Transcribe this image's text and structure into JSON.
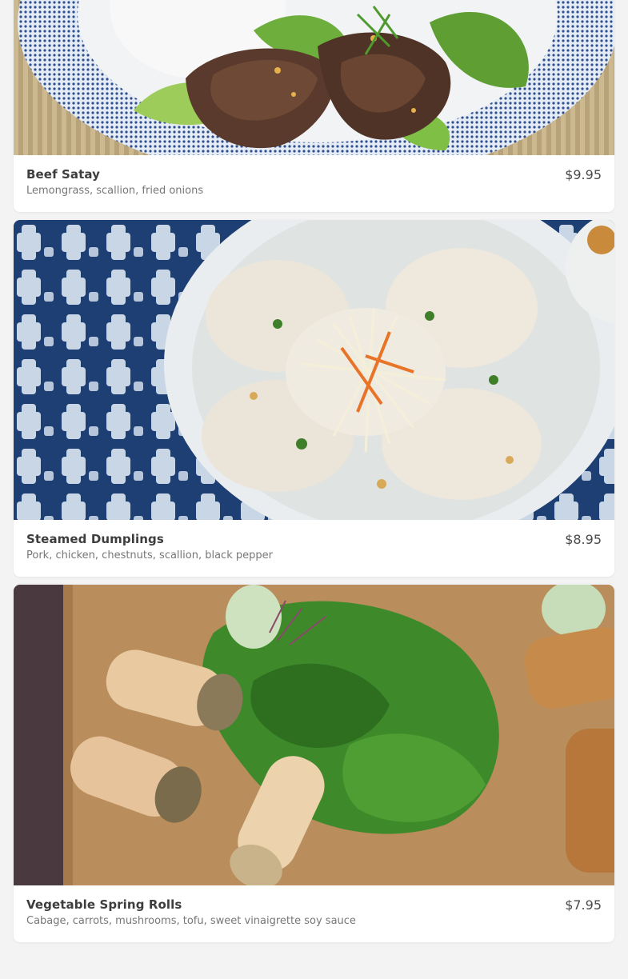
{
  "menu_items": [
    {
      "name": "Beef Satay",
      "description": "Lemongrass, scallion, fried onions",
      "price": "$9.95",
      "photo_icon": "beef-satay-photo"
    },
    {
      "name": "Steamed Dumplings",
      "description": "Pork, chicken, chestnuts, scallion, black pepper",
      "price": "$8.95",
      "photo_icon": "steamed-dumplings-photo"
    },
    {
      "name": "Vegetable Spring Rolls",
      "description": "Cabage, carrots, mushrooms, tofu, sweet vinaigrette soy sauce",
      "price": "$7.95",
      "photo_icon": "spring-rolls-photo"
    }
  ],
  "colors": {
    "page_background": "#f3f3f4",
    "card_background": "#ffffff",
    "title_text": "#3d3d3d",
    "description_text": "#777777",
    "price_text": "#4a4a4a"
  }
}
